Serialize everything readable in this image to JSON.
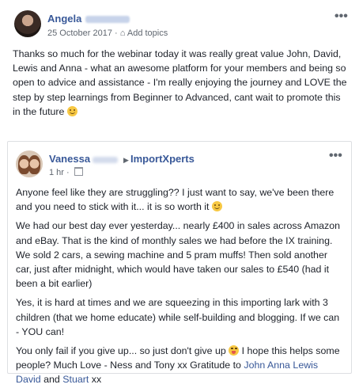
{
  "post1": {
    "author_first": "Angela",
    "date": "25 October 2017",
    "separator": "·",
    "add_topics": "Add topics",
    "more": "•••",
    "text": "Thanks so much for the webinar today it was really great value John, David, Lewis and Anna - what an awesome platform for your members and being so open to advice and assistance - I'm really enjoying the journey and LOVE the step by step learnings from Beginner to Advanced, cant wait to promote this in the future",
    "emoji": "smile-emoji"
  },
  "post2": {
    "author_first": "Vanessa",
    "group": "ImportXperts",
    "time": "1 hr",
    "separator": "·",
    "more": "•••",
    "para1": "Anyone feel like they are struggling?? I just want to say, we've been there and you need to stick with it... it is so worth it",
    "para2": "We had our best day ever yesterday... nearly £400 in sales across Amazon and eBay. That is the kind of monthly sales we had before the IX training. We sold 2 cars, a sewing machine and 5 pram muffs! Then sold another car, just after midnight, which would have taken our sales to £540 (had it been a bit earlier)",
    "para3": "Yes, it is hard at times and we are squeezing in this importing lark with 3 children (that we home educate) while self-building and blogging. If we can - YOU can!",
    "para4_a": "You only fail if you give up... so just don't give up",
    "para4_b": " I hope this helps some people? Much Love - Ness and Tony xx Gratitude to ",
    "tag_john": "John",
    "tag_anna": "Anna",
    "tag_lewis": "Lewis",
    "tag_david": "David",
    "and": "and",
    "tag_stuart": "Stuart",
    "end": "xx"
  },
  "colors": {
    "link": "#385898",
    "meta": "#606770",
    "text": "#1d2129",
    "border": "#dddfe2"
  }
}
